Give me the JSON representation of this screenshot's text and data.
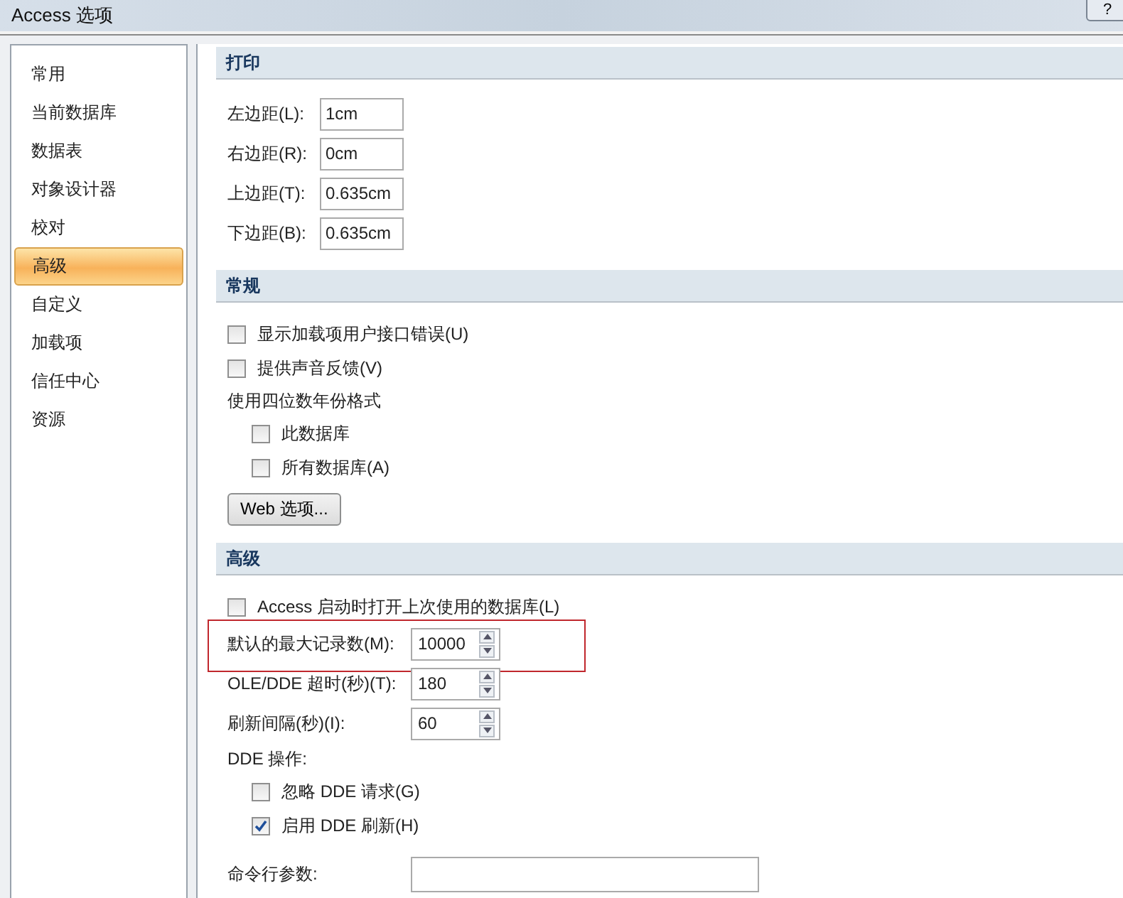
{
  "window": {
    "title": "Access 选项",
    "help_button": "?"
  },
  "sidebar": {
    "items": [
      {
        "label": "常用",
        "selected": false
      },
      {
        "label": "当前数据库",
        "selected": false
      },
      {
        "label": "数据表",
        "selected": false
      },
      {
        "label": "对象设计器",
        "selected": false
      },
      {
        "label": "校对",
        "selected": false
      },
      {
        "label": "高级",
        "selected": true
      },
      {
        "label": "自定义",
        "selected": false
      },
      {
        "label": "加载项",
        "selected": false
      },
      {
        "label": "信任中心",
        "selected": false
      },
      {
        "label": "资源",
        "selected": false
      }
    ]
  },
  "sections": [
    {
      "title": "打印",
      "items": [
        {
          "kind": "field",
          "label": "左边距(L):",
          "value": "1cm"
        },
        {
          "kind": "field",
          "label": "右边距(R):",
          "value": "0cm"
        },
        {
          "kind": "field",
          "label": "上边距(T):",
          "value": "0.635cm"
        },
        {
          "kind": "field",
          "label": "下边距(B):",
          "value": "0.635cm"
        }
      ]
    },
    {
      "title": "常规",
      "items": [
        {
          "kind": "checkbox",
          "label": "显示加载项用户接口错误(U)",
          "checked": false,
          "indented": false
        },
        {
          "kind": "checkbox",
          "label": "提供声音反馈(V)",
          "checked": false,
          "indented": false
        },
        {
          "kind": "text",
          "label": "使用四位数年份格式"
        },
        {
          "kind": "checkbox",
          "label": "此数据库",
          "checked": false,
          "indented": true
        },
        {
          "kind": "checkbox",
          "label": "所有数据库(A)",
          "checked": false,
          "indented": true
        },
        {
          "kind": "button",
          "label": "Web 选项..."
        }
      ]
    },
    {
      "title": "高级",
      "items": [
        {
          "kind": "checkbox",
          "label": "Access 启动时打开上次使用的数据库(L)",
          "checked": false,
          "indented": false
        },
        {
          "kind": "spin",
          "label": "默认的最大记录数(M):",
          "value": "10000",
          "highlighted": true
        },
        {
          "kind": "spin",
          "label": "OLE/DDE 超时(秒)(T):",
          "value": "180",
          "highlighted": false
        },
        {
          "kind": "spin",
          "label": "刷新间隔(秒)(I):",
          "value": "60",
          "highlighted": false
        },
        {
          "kind": "text",
          "label": "DDE 操作:"
        },
        {
          "kind": "checkbox",
          "label": "忽略 DDE 请求(G)",
          "checked": false,
          "indented": true
        },
        {
          "kind": "checkbox",
          "label": "启用 DDE 刷新(H)",
          "checked": true,
          "indented": true
        },
        {
          "kind": "textbox",
          "label": "命令行参数:"
        }
      ]
    }
  ]
}
